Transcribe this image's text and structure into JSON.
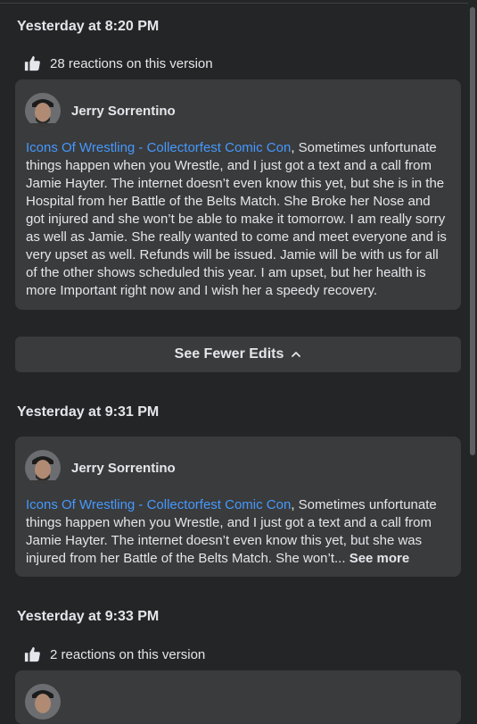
{
  "edits": [
    {
      "timestamp": "Yesterday at 8:20 PM",
      "reactions": "28 reactions on this version",
      "author": "Jerry Sorrentino",
      "link": "Icons Of Wrestling - Collectorfest Comic Con",
      "text": ", Sometimes unfortunate things happen when you Wrestle, and I just got a text and a call from Jamie Hayter. The internet doesn’t even know this yet, but she is in the Hospital from her Battle of the Belts Match. She Broke her Nose and got injured and she won’t be able to make it tomorrow. I am really sorry as well as Jamie. She really wanted to come and meet everyone and is very upset as well. Refunds will be issued. Jamie will be with us for all of the other shows scheduled this year. I am upset, but her health is more Important right now and I wish her a speedy recovery."
    },
    {
      "timestamp": "Yesterday at 9:31 PM",
      "author": "Jerry Sorrentino",
      "link": "Icons Of Wrestling - Collectorfest Comic Con",
      "text": ", Sometimes unfortunate things happen when you Wrestle, and I just got a text and a call from Jamie Hayter. The internet doesn’t even know this yet, but she was injured from her Battle of the Belts Match. She won’t...",
      "see_more": "See more"
    },
    {
      "timestamp": "Yesterday at 9:33 PM",
      "reactions": "2 reactions on this version"
    }
  ],
  "see_fewer_label": "See Fewer Edits",
  "icons": [
    "like-icon",
    "chevron-up-icon",
    "avatar"
  ],
  "colors": {
    "background": "#242526",
    "card": "#3a3b3c",
    "link": "#4599ff",
    "text": "#e4e6eb"
  }
}
